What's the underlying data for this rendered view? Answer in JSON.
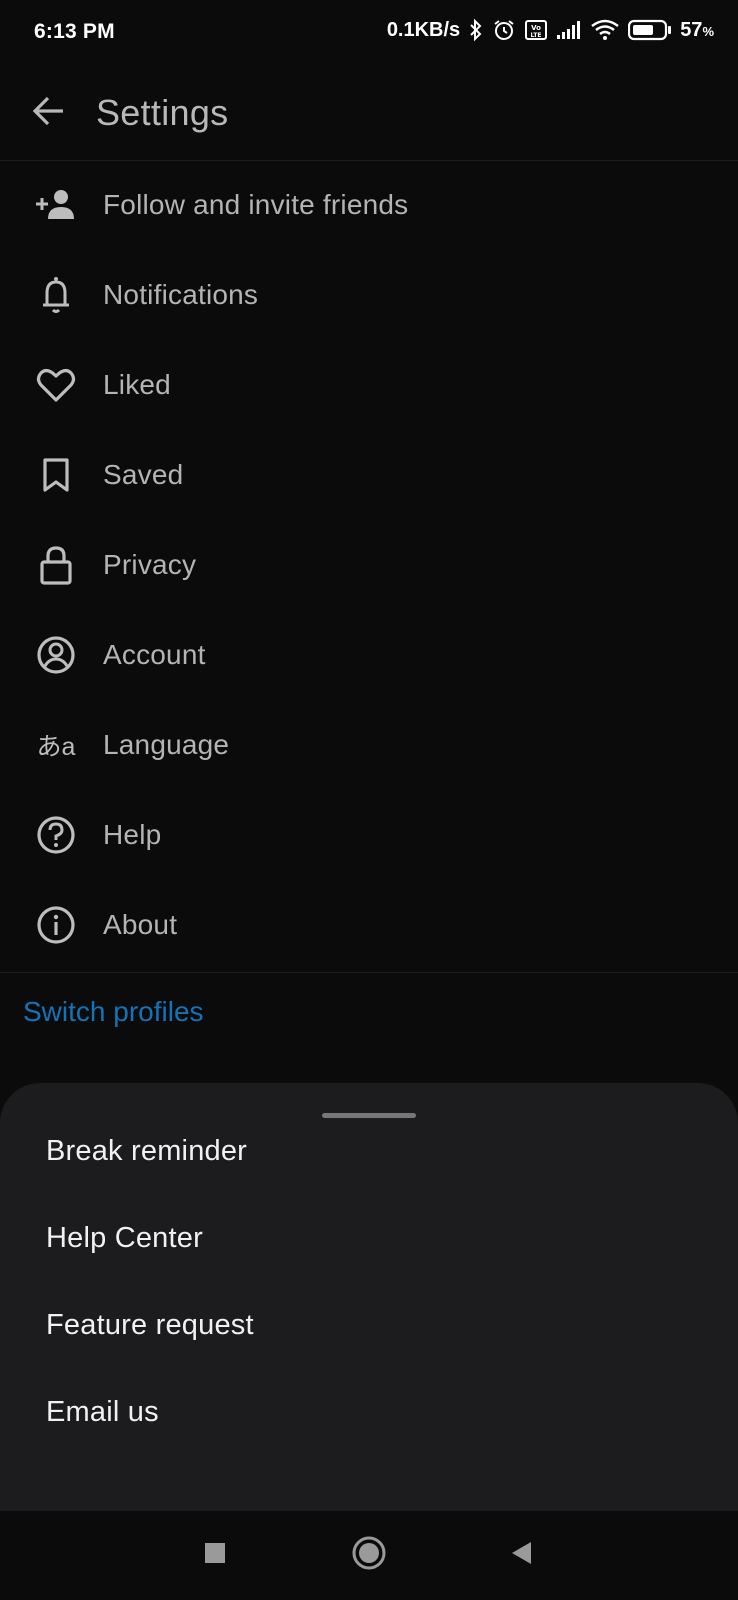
{
  "status_bar": {
    "time": "6:13 PM",
    "network_speed": "0.1KB/s",
    "battery_percent": "57",
    "battery_unit": "%",
    "icons": [
      "bluetooth-icon",
      "alarm-icon",
      "volte-icon",
      "signal-icon",
      "wifi-icon",
      "battery-icon"
    ]
  },
  "appbar": {
    "title": "Settings",
    "back_icon": "arrow-left-icon"
  },
  "settings": {
    "items": [
      {
        "label": "Follow and invite friends",
        "icon": "person-add-icon"
      },
      {
        "label": "Notifications",
        "icon": "bell-icon"
      },
      {
        "label": "Liked",
        "icon": "heart-icon"
      },
      {
        "label": "Saved",
        "icon": "bookmark-icon"
      },
      {
        "label": "Privacy",
        "icon": "lock-icon"
      },
      {
        "label": "Account",
        "icon": "account-circle-icon"
      },
      {
        "label": "Language",
        "icon": "language-icon",
        "glyph": "あa"
      },
      {
        "label": "Help",
        "icon": "help-circle-icon"
      },
      {
        "label": "About",
        "icon": "info-circle-icon"
      }
    ],
    "switch_profiles": "Switch profiles"
  },
  "sheet": {
    "items": [
      "Break reminder",
      "Help Center",
      "Feature request",
      "Email us"
    ]
  },
  "navbar": {
    "icons": [
      "recents-square-icon",
      "home-circle-icon",
      "back-triangle-icon"
    ]
  },
  "colors": {
    "background": "#0b0b0c",
    "sheet": "#1c1c1e",
    "accent": "#1672b8",
    "text": "#b4b4b4"
  }
}
